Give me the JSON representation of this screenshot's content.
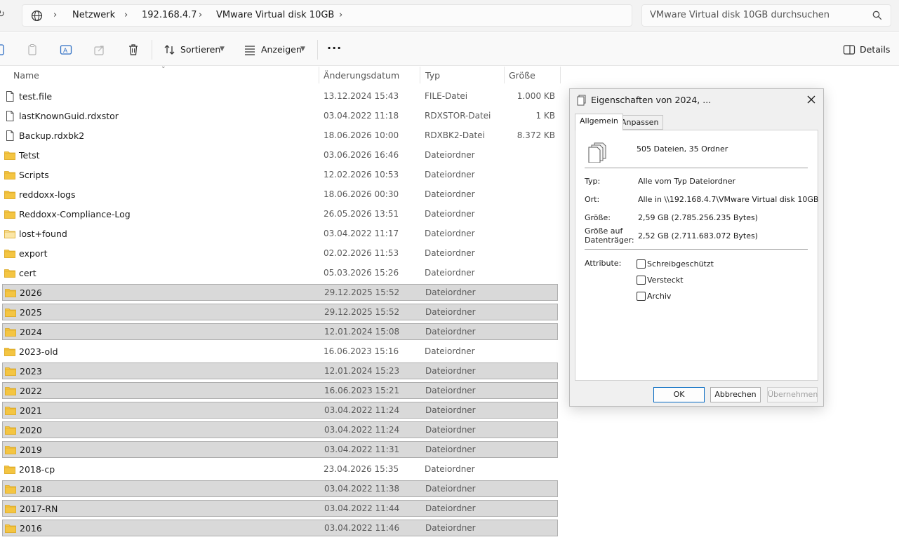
{
  "address": {
    "crumbs": [
      "Netzwerk",
      "192.168.4.7",
      "VMware Virtual disk 10GB"
    ],
    "search_placeholder": "VMware Virtual disk 10GB durchsuchen"
  },
  "toolbar": {
    "sort_label": "Sortieren",
    "view_label": "Anzeigen",
    "details_label": "Details"
  },
  "columns": {
    "name": "Name",
    "date": "Änderungsdatum",
    "type": "Typ",
    "size": "Größe"
  },
  "files": [
    {
      "name": "test.file",
      "date": "13.12.2024 15:43",
      "type": "FILE-Datei",
      "size": "1.000 KB",
      "kind": "file",
      "selected": false
    },
    {
      "name": "lastKnownGuid.rdxstor",
      "date": "03.04.2022 11:18",
      "type": "RDXSTOR-Datei",
      "size": "1 KB",
      "kind": "file",
      "selected": false
    },
    {
      "name": "Backup.rdxbk2",
      "date": "18.06.2026 10:00",
      "type": "RDXBK2-Datei",
      "size": "8.372 KB",
      "kind": "file",
      "selected": false
    },
    {
      "name": "Tetst",
      "date": "03.06.2026 16:46",
      "type": "Dateiordner",
      "size": "",
      "kind": "folder",
      "selected": false
    },
    {
      "name": "Scripts",
      "date": "12.02.2026 10:53",
      "type": "Dateiordner",
      "size": "",
      "kind": "folder",
      "selected": false
    },
    {
      "name": "reddoxx-logs",
      "date": "18.06.2026 00:30",
      "type": "Dateiordner",
      "size": "",
      "kind": "folder",
      "selected": false
    },
    {
      "name": "Reddoxx-Compliance-Log",
      "date": "26.05.2026 13:51",
      "type": "Dateiordner",
      "size": "",
      "kind": "folder",
      "selected": false
    },
    {
      "name": "lost+found",
      "date": "03.04.2022 11:17",
      "type": "Dateiordner",
      "size": "",
      "kind": "folder-light",
      "selected": false
    },
    {
      "name": "export",
      "date": "02.02.2026 11:53",
      "type": "Dateiordner",
      "size": "",
      "kind": "folder",
      "selected": false
    },
    {
      "name": "cert",
      "date": "05.03.2026 15:26",
      "type": "Dateiordner",
      "size": "",
      "kind": "folder",
      "selected": false
    },
    {
      "name": "2026",
      "date": "29.12.2025 15:52",
      "type": "Dateiordner",
      "size": "",
      "kind": "folder",
      "selected": true
    },
    {
      "name": "2025",
      "date": "29.12.2025 15:52",
      "type": "Dateiordner",
      "size": "",
      "kind": "folder",
      "selected": true
    },
    {
      "name": "2024",
      "date": "12.01.2024 15:08",
      "type": "Dateiordner",
      "size": "",
      "kind": "folder",
      "selected": true
    },
    {
      "name": "2023-old",
      "date": "16.06.2023 15:16",
      "type": "Dateiordner",
      "size": "",
      "kind": "folder",
      "selected": false
    },
    {
      "name": "2023",
      "date": "12.01.2024 15:23",
      "type": "Dateiordner",
      "size": "",
      "kind": "folder",
      "selected": true
    },
    {
      "name": "2022",
      "date": "16.06.2023 15:21",
      "type": "Dateiordner",
      "size": "",
      "kind": "folder",
      "selected": true
    },
    {
      "name": "2021",
      "date": "03.04.2022 11:24",
      "type": "Dateiordner",
      "size": "",
      "kind": "folder",
      "selected": true
    },
    {
      "name": "2020",
      "date": "03.04.2022 11:24",
      "type": "Dateiordner",
      "size": "",
      "kind": "folder",
      "selected": true
    },
    {
      "name": "2019",
      "date": "03.04.2022 11:31",
      "type": "Dateiordner",
      "size": "",
      "kind": "folder",
      "selected": true
    },
    {
      "name": "2018-cp",
      "date": "23.04.2026 15:35",
      "type": "Dateiordner",
      "size": "",
      "kind": "folder",
      "selected": false
    },
    {
      "name": "2018",
      "date": "03.04.2022 11:38",
      "type": "Dateiordner",
      "size": "",
      "kind": "folder",
      "selected": true
    },
    {
      "name": "2017-RN",
      "date": "03.04.2022 11:44",
      "type": "Dateiordner",
      "size": "",
      "kind": "folder",
      "selected": true
    },
    {
      "name": "2016",
      "date": "03.04.2022 11:46",
      "type": "Dateiordner",
      "size": "",
      "kind": "folder",
      "selected": true
    }
  ],
  "dialog": {
    "title": "Eigenschaften von 2024, ...",
    "tab_general": "Allgemein",
    "tab_customize": "Anpassen",
    "summary": "505 Dateien, 35 Ordner",
    "type_label": "Typ:",
    "type_value": "Alle vom Typ Dateiordner",
    "location_label": "Ort:",
    "location_value": "Alle in \\\\192.168.4.7\\VMware Virtual disk 10GB",
    "size_label": "Größe:",
    "size_value": "2,59 GB (2.785.256.235 Bytes)",
    "disk_size_label_1": "Größe auf",
    "disk_size_label_2": "Datenträger:",
    "disk_size_value": "2,52 GB (2.711.683.072 Bytes)",
    "attributes_label": "Attribute:",
    "attr_readonly": "Schreibgeschützt",
    "attr_hidden": "Versteckt",
    "attr_archive": "Archiv",
    "btn_ok": "OK",
    "btn_cancel": "Abbrechen",
    "btn_apply": "Übernehmen"
  },
  "colors": {
    "folder": "#f4c542",
    "folder_light": "#fbe6a6",
    "selection": "#d9d9d9",
    "accent": "#0067c0"
  }
}
